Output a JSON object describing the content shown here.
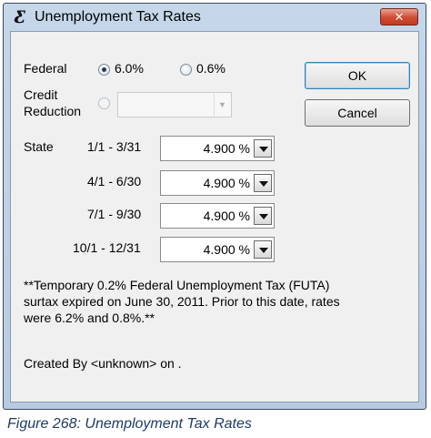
{
  "window": {
    "title": "Unemployment Tax Rates",
    "app_icon_glyph": "Ƹ",
    "close_glyph": "✕"
  },
  "federal": {
    "label": "Federal",
    "options": [
      {
        "label": "6.0%",
        "checked": true
      },
      {
        "label": "0.6%",
        "checked": false
      }
    ]
  },
  "credit_reduction": {
    "label_line1": "Credit",
    "label_line2": "Reduction",
    "value": ""
  },
  "state": {
    "label": "State",
    "periods": [
      {
        "range": "1/1 - 3/31",
        "rate": "4.900 %"
      },
      {
        "range": "4/1 - 6/30",
        "rate": "4.900 %"
      },
      {
        "range": "7/1 - 9/30",
        "rate": "4.900 %"
      },
      {
        "range": "10/1 - 12/31",
        "rate": "4.900 %"
      }
    ]
  },
  "buttons": {
    "ok": "OK",
    "cancel": "Cancel"
  },
  "note": {
    "line1": "**Temporary 0.2% Federal Unemployment Tax (FUTA)",
    "line2": "surtax expired on June 30, 2011.  Prior to this date, rates",
    "line3": "were 6.2% and 0.8%.**"
  },
  "created_by": "Created By <unknown> on .",
  "caption": "Figure 268: Unemployment Tax Rates"
}
